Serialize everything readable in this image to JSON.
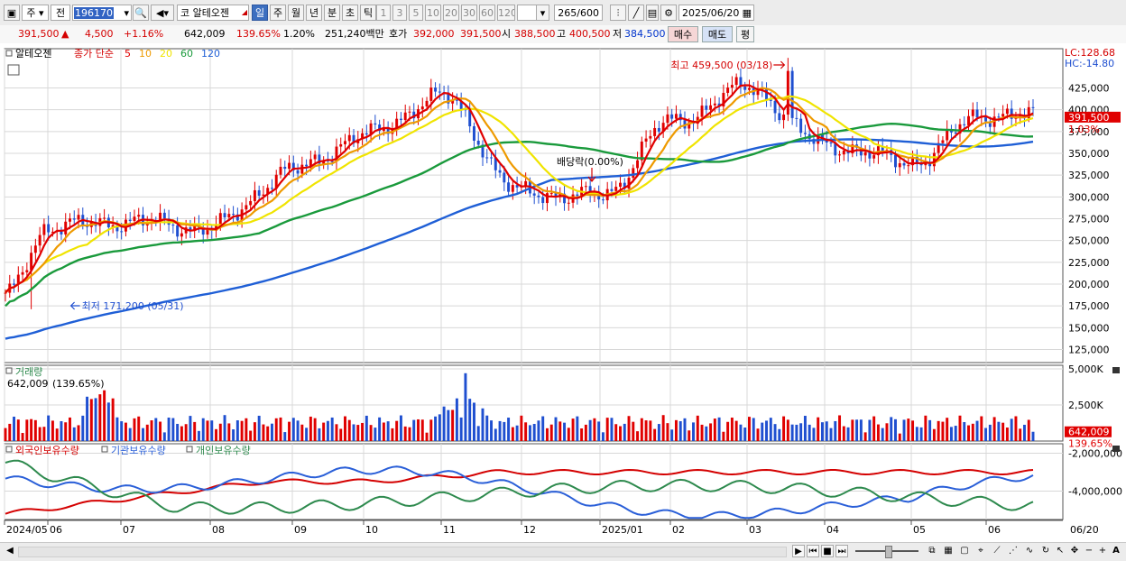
{
  "toolbar": {
    "market_label": "주",
    "scope_label": "전",
    "stock_code": "196170",
    "market_tag": "코",
    "stock_name": "알테오젠",
    "periods": [
      "일",
      "주",
      "월",
      "년",
      "분",
      "초",
      "틱"
    ],
    "active_period": "일",
    "minute_options": [
      "1",
      "3",
      "5",
      "10",
      "20",
      "30",
      "60",
      "120"
    ],
    "count_value": "265",
    "count_total": "/600",
    "date_value": "2025/06/20"
  },
  "quote": {
    "price": "391,500",
    "change_arrow": "▲",
    "change": "4,500",
    "change_pct": "+1.16%",
    "volume": "642,009",
    "volume_ratio": "139.65%",
    "turnover_pct": "1.20%",
    "amount": "251,240백만",
    "bid_ask_label": "호가",
    "ask_price": "392,000",
    "bid_price": "391,500",
    "open_label": "시",
    "open_price": "388,500",
    "high_label": "고",
    "high_price": "400,500",
    "low_label": "저",
    "low_price": "384,500",
    "buy_label": "매수",
    "sell_label": "매도",
    "eval_label": "평"
  },
  "price_panel": {
    "legend_name": "알테오젠",
    "legend_series": "종가 단순",
    "ma_periods": [
      "5",
      "10",
      "20",
      "60",
      "120"
    ],
    "ma_colors": [
      "#e00000",
      "#ee9a00",
      "#f0e400",
      "#1a9a3c",
      "#1f5fd6"
    ],
    "lc_label": "LC:128.68",
    "hc_label": "HC:-14.80",
    "y_ticks": [
      "425,000",
      "400,000",
      "375,000",
      "350,000",
      "325,000",
      "300,000",
      "275,000",
      "250,000",
      "225,000",
      "200,000",
      "175,000",
      "150,000",
      "125,000"
    ],
    "current_price_tag": "391,500",
    "current_pct_tag": "1.03%",
    "high_annotation": "최고 459,500 (03/18)",
    "low_annotation": "최저 171,200 (05/31)",
    "dividend_annotation": "배당락(0.00%)"
  },
  "volume_panel": {
    "title": "거래량",
    "value_text": "642,009",
    "ratio_text": "(139.65%)",
    "y_ticks": [
      "5,000K",
      "2,500K"
    ],
    "volume_tag": "642,009",
    "ratio_tag": "139.65%"
  },
  "holdings_panel": {
    "series": [
      "외국인보유수량",
      "기관보유수량",
      "개인보유수량"
    ],
    "series_colors": [
      "#d40000",
      "#2a5fd8",
      "#2e8a4e"
    ],
    "y_ticks": [
      "-2,000,000",
      "-4,000,000"
    ]
  },
  "x_axis": {
    "labels": [
      "2024/05",
      "06",
      "07",
      "08",
      "09",
      "10",
      "11",
      "12",
      "2025/01",
      "02",
      "03",
      "04",
      "05",
      "06"
    ],
    "right_label": "06/20"
  },
  "chart_data": [
    {
      "type": "candlestick",
      "title": "알테오젠",
      "y_range": [
        110000,
        470000
      ],
      "high": {
        "value": 459500,
        "date": "03/18"
      },
      "low": {
        "value": 171200,
        "date": "05/31"
      },
      "last_close": 391500,
      "key_closes": [
        {
          "label": "2024/05",
          "value": 185000
        },
        {
          "label": "06",
          "value": 265000
        },
        {
          "label": "07",
          "value": 272000
        },
        {
          "label": "08",
          "value": 265000
        },
        {
          "label": "09",
          "value": 330000
        },
        {
          "label": "10",
          "value": 370000
        },
        {
          "label": "11",
          "value": 415000
        },
        {
          "label": "12",
          "value": 305000
        },
        {
          "label": "2025/01",
          "value": 300000
        },
        {
          "label": "02",
          "value": 385000
        },
        {
          "label": "03",
          "value": 425000
        },
        {
          "label": "04",
          "value": 360000
        },
        {
          "label": "05",
          "value": 340000
        },
        {
          "label": "06",
          "value": 395000
        }
      ]
    },
    {
      "type": "bar",
      "title": "거래량",
      "last_value": 642009,
      "y_range": [
        0,
        5000000
      ]
    },
    {
      "type": "line",
      "series": [
        {
          "name": "외국인보유수량"
        },
        {
          "name": "기관보유수량"
        },
        {
          "name": "개인보유수량"
        }
      ],
      "y_range": [
        -5500000,
        -1500000
      ]
    }
  ]
}
